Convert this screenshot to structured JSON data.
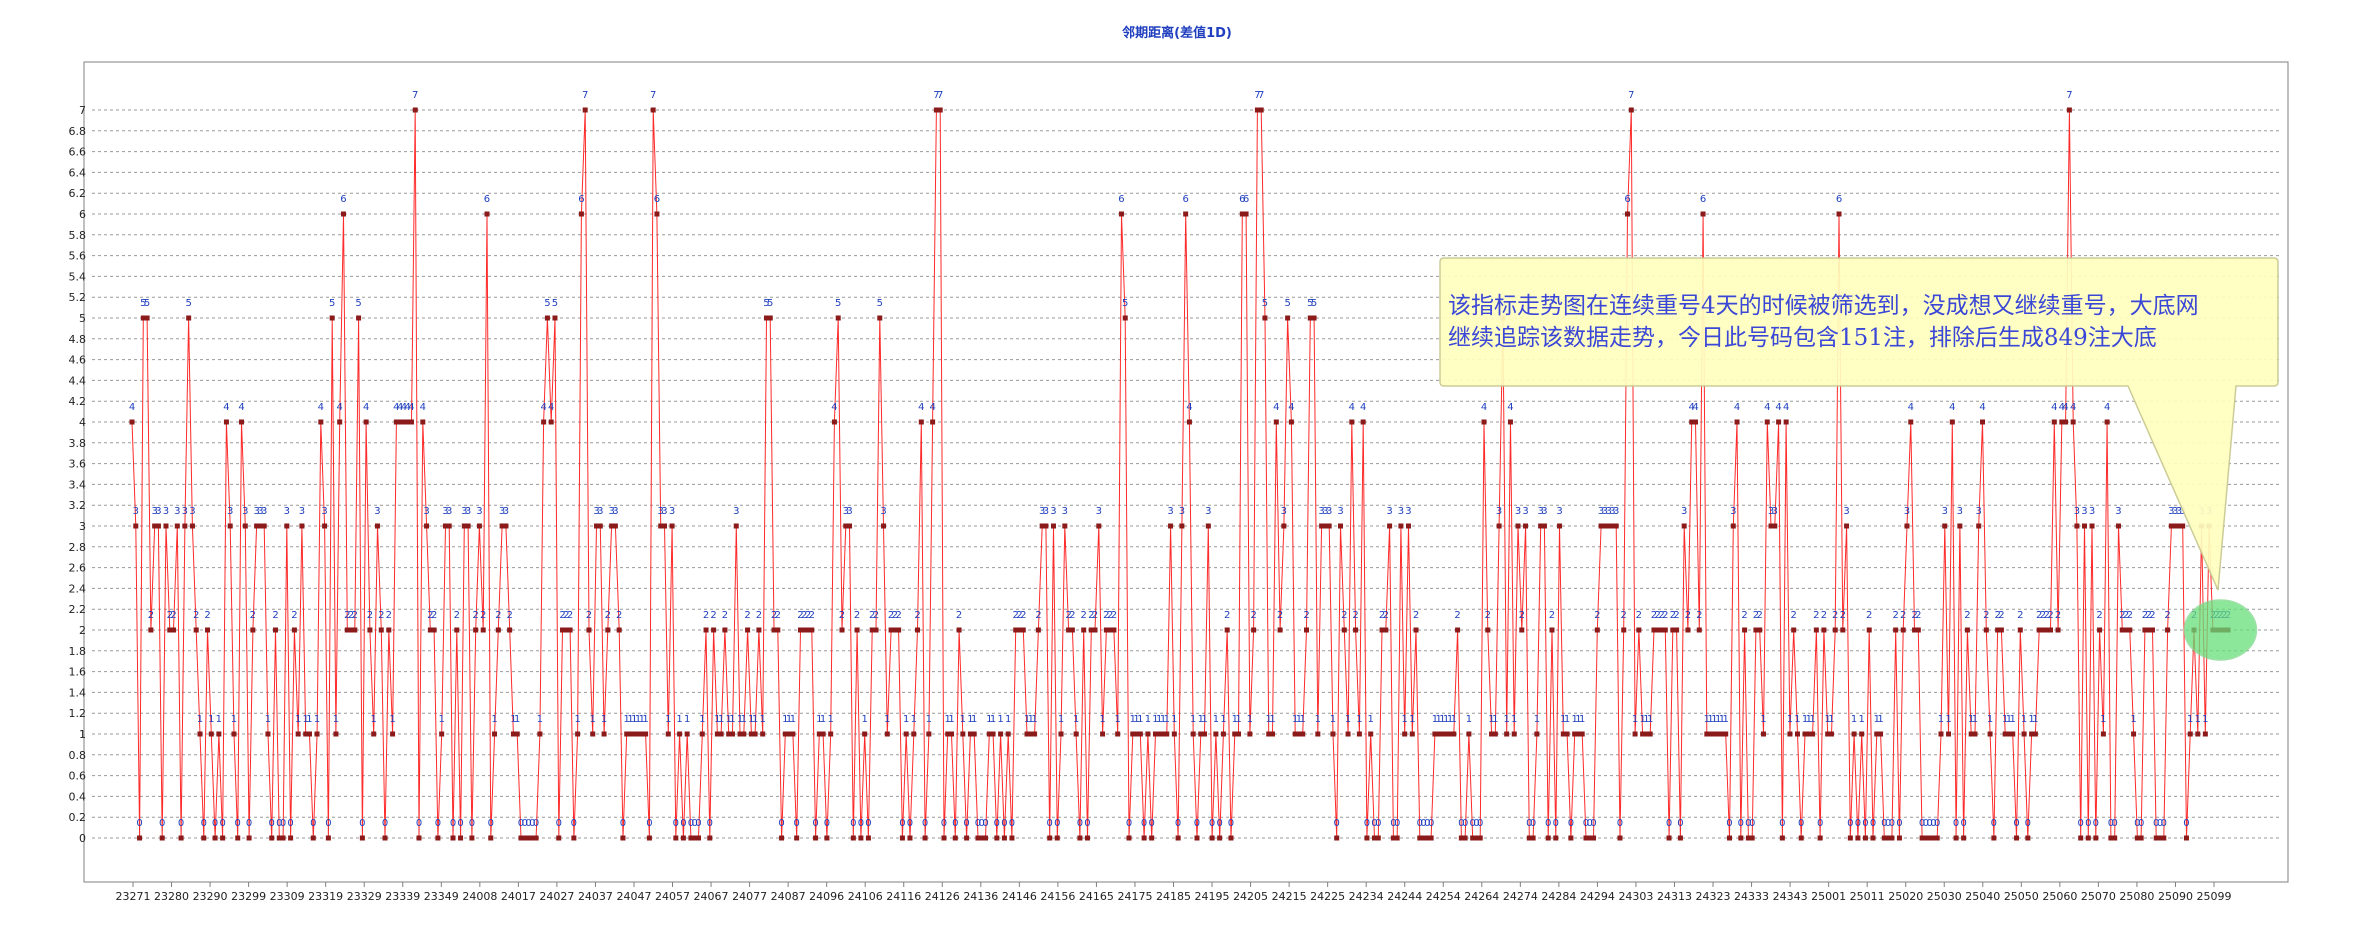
{
  "chart_data": {
    "type": "line",
    "title": "邻期距离(差值1D)",
    "xlabel": "",
    "ylabel": "",
    "ylim": [
      -0.2,
      7.6
    ],
    "yticks": [
      0,
      0.2,
      0.4,
      0.6,
      0.8,
      1,
      1.2,
      1.4,
      1.6,
      1.8,
      2,
      2.2,
      2.4,
      2.6,
      2.8,
      3,
      3.2,
      3.4,
      3.6,
      3.8,
      4,
      4.2,
      4.4,
      4.6,
      4.8,
      5,
      5.2,
      5.4,
      5.6,
      5.8,
      6,
      6.2,
      6.4,
      6.6,
      6.8,
      7
    ],
    "xtick_labels": [
      "23271",
      "23280",
      "23290",
      "23299",
      "23309",
      "23319",
      "23329",
      "23339",
      "23349",
      "24008",
      "24017",
      "24027",
      "24037",
      "24047",
      "24057",
      "24067",
      "24077",
      "24087",
      "24096",
      "24106",
      "24116",
      "24126",
      "24136",
      "24146",
      "24156",
      "24165",
      "24175",
      "24185",
      "24195",
      "24205",
      "24215",
      "24225",
      "24234",
      "24244",
      "24254",
      "24264",
      "24274",
      "24284",
      "24294",
      "24303",
      "24313",
      "24323",
      "24333",
      "24343",
      "25001",
      "25011",
      "25020",
      "25030",
      "25040",
      "25050",
      "25060",
      "25070",
      "25080",
      "25090",
      "25099"
    ],
    "grid": true,
    "line_color": "#ff2a2a",
    "marker_color": "#8b1a1a",
    "label_color": "#1f3fbf",
    "values": [
      4,
      3,
      0,
      5,
      5,
      2,
      3,
      3,
      0,
      3,
      2,
      2,
      3,
      0,
      3,
      5,
      3,
      2,
      1,
      0,
      2,
      1,
      0,
      1,
      0,
      4,
      3,
      1,
      0,
      4,
      3,
      0,
      2,
      3,
      3,
      3,
      1,
      0,
      2,
      0,
      0,
      3,
      0,
      2,
      1,
      3,
      1,
      1,
      0,
      1,
      4,
      3,
      0,
      5,
      1,
      4,
      6,
      2,
      2,
      2,
      5,
      0,
      4,
      2,
      1,
      3,
      2,
      0,
      2,
      1,
      4,
      4,
      4,
      4,
      4,
      7,
      0,
      4,
      3,
      2,
      2,
      0,
      1,
      3,
      3,
      0,
      2,
      0,
      3,
      3,
      0,
      2,
      3,
      2,
      6,
      0,
      1,
      2,
      3,
      3,
      2,
      1,
      1,
      0,
      0,
      0,
      0,
      0,
      1,
      4,
      5,
      4,
      5,
      0,
      2,
      2,
      2,
      0,
      1,
      6,
      7,
      2,
      1,
      3,
      3,
      1,
      2,
      3,
      3,
      2,
      0,
      1,
      1,
      1,
      1,
      1,
      1,
      0,
      7,
      6,
      3,
      3,
      1,
      3,
      0,
      1,
      0,
      1,
      0,
      0,
      0,
      1,
      2,
      0,
      2,
      1,
      1,
      2,
      1,
      1,
      3,
      1,
      1,
      2,
      1,
      1,
      2,
      1,
      5,
      5,
      2,
      2,
      0,
      1,
      1,
      1,
      0,
      2,
      2,
      2,
      2,
      0,
      1,
      1,
      0,
      1,
      4,
      5,
      2,
      3,
      3,
      0,
      2,
      0,
      1,
      0,
      2,
      2,
      5,
      3,
      1,
      2,
      2,
      2,
      0,
      1,
      0,
      1,
      2,
      4,
      0,
      1,
      4,
      7,
      7,
      0,
      1,
      1,
      0,
      2,
      1,
      0,
      1,
      1,
      0,
      0,
      0,
      1,
      1,
      0,
      1,
      0,
      1,
      0,
      2,
      2,
      2,
      1,
      1,
      1,
      2,
      3,
      3,
      0,
      3,
      0,
      1,
      3,
      2,
      2,
      1,
      0,
      2,
      0,
      2,
      2,
      3,
      1,
      2,
      2,
      2,
      1,
      6,
      5,
      0,
      1,
      1,
      1,
      0,
      1,
      0,
      1,
      1,
      1,
      1,
      3,
      1,
      0,
      3,
      6,
      4,
      1,
      0,
      1,
      1,
      3,
      0,
      1,
      0,
      1,
      2,
      0,
      1,
      1,
      6,
      6,
      1,
      2,
      7,
      7,
      5,
      1,
      1,
      4,
      2,
      3,
      5,
      4,
      1,
      1,
      1,
      2,
      5,
      5,
      1,
      3,
      3,
      3,
      1,
      0,
      3,
      2,
      1,
      4,
      2,
      1,
      4,
      0,
      1,
      0,
      0,
      2,
      2,
      3,
      0,
      0,
      3,
      1,
      3,
      1,
      2,
      0,
      0,
      0,
      0,
      1,
      1,
      1,
      1,
      1,
      1,
      2,
      0,
      0,
      1,
      0,
      0,
      0,
      4,
      2,
      1,
      1,
      3,
      5,
      1,
      4,
      1,
      3,
      2,
      3,
      0,
      0,
      1,
      3,
      3,
      0,
      2,
      0,
      3,
      1,
      1,
      0,
      1,
      1,
      1,
      0,
      0,
      0,
      2,
      3,
      3,
      3,
      3,
      3,
      0,
      2,
      6,
      7,
      1,
      2,
      1,
      1,
      1,
      2,
      2,
      2,
      2,
      0,
      2,
      2,
      0,
      3,
      2,
      4,
      4,
      2,
      6,
      1,
      1,
      1,
      1,
      1,
      1,
      0,
      3,
      4,
      0,
      2,
      0,
      0,
      2,
      2,
      1,
      4,
      3,
      3,
      4,
      0,
      4,
      1,
      2,
      1,
      0,
      1,
      1,
      1,
      2,
      0,
      2,
      1,
      1,
      2,
      6,
      2,
      3,
      0,
      1,
      0,
      1,
      0,
      2,
      0,
      1,
      1,
      0,
      0,
      0,
      2,
      0,
      2,
      3,
      4,
      2,
      2,
      0,
      0,
      0,
      0,
      0,
      1,
      3,
      1,
      4,
      0,
      3,
      0,
      2,
      1,
      1,
      3,
      4,
      2,
      1,
      0,
      2,
      2,
      1,
      1,
      1,
      0,
      2,
      1,
      0,
      1,
      1,
      2,
      2,
      2,
      2,
      4,
      2,
      4,
      4,
      7,
      4,
      3,
      0,
      3,
      0,
      3,
      0,
      2,
      1,
      4,
      0,
      0,
      3,
      2,
      2,
      2,
      1,
      0,
      0,
      2,
      2,
      2,
      0,
      0,
      0,
      2,
      3,
      3,
      3,
      3,
      0,
      1,
      2,
      1,
      3,
      1,
      3,
      2,
      2,
      2,
      2,
      2
    ]
  },
  "annotation": {
    "text_line1": "该指标走势图在连续重号4天的时候被筛选到，没成想又继续重号，大底网",
    "text_line2": "继续追踪该数据走势，今日此号码包含151注，排除后生成849注大底",
    "bubble_color": "#ffffc0",
    "highlight_color": "#66e07a"
  }
}
